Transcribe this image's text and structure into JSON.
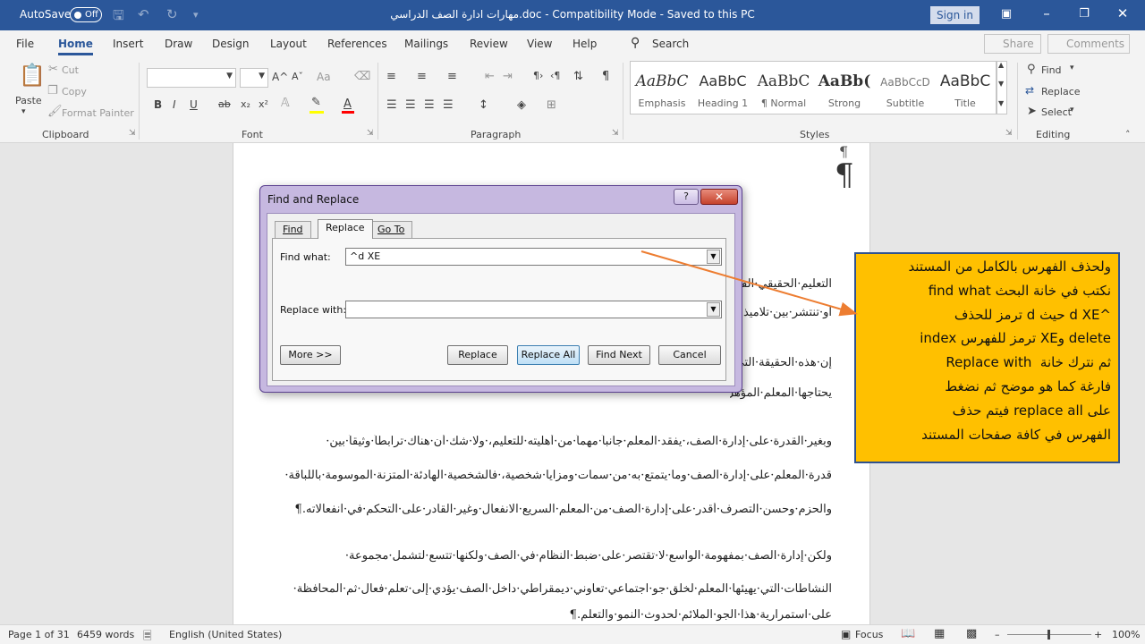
{
  "titlebar": {
    "autosave_label": "AutoSave",
    "autosave_state": "Off",
    "doc_title": "مهارات ادارة الصف الدراسي.doc  -  Compatibility Mode  -  Saved to this PC",
    "signin_label": "Sign in"
  },
  "menu": {
    "tabs": [
      "File",
      "Home",
      "Insert",
      "Draw",
      "Design",
      "Layout",
      "References",
      "Mailings",
      "Review",
      "View",
      "Help"
    ],
    "search_label": "Search",
    "share_label": "Share",
    "comments_label": "Comments"
  },
  "ribbon": {
    "clipboard": {
      "paste": "Paste",
      "cut": "Cut",
      "copy": "Copy",
      "format_painter": "Format Painter",
      "label": "Clipboard"
    },
    "font": {
      "label": "Font",
      "bold": "B",
      "italic": "I",
      "underline": "U",
      "strike": "ab",
      "subscript": "x₂",
      "superscript": "x²",
      "grow": "A^",
      "shrink": "Aˇ",
      "case": "Aa",
      "highlight_color": "#ffff00",
      "font_color": "#ff0000"
    },
    "paragraph": {
      "label": "Paragraph"
    },
    "styles": {
      "label": "Styles",
      "items": [
        {
          "sample": "AaBbC",
          "name": "Emphasis"
        },
        {
          "sample": "AaBbC",
          "name": "Heading 1"
        },
        {
          "sample": "AaBbC",
          "name": "¶ Normal"
        },
        {
          "sample": "AaBb(",
          "name": "Strong"
        },
        {
          "sample": "AaBbCcD",
          "name": "Subtitle"
        },
        {
          "sample": "AaBbC",
          "name": "Title"
        }
      ]
    },
    "editing": {
      "find": "Find",
      "replace": "Replace",
      "select": "Select",
      "label": "Editing"
    }
  },
  "document": {
    "pilcrow": "¶",
    "paragraphs": [
      "التعليم·الحقيقي·الفعال",
      "أو·تنتشر·بين·تلاميذه",
      "إن·هذه·الحقيقة·التي",
      "يحتاجها·المعلم·المؤهل.¶",
      "وبغير·القدرة·على·إدارة·الصف،·يفقد·المعلم·جانباً·مهماً·من·أهليته·للتعليم،·ولا·شك·أن·هناك·ترابطاً·وثيقاً·بين·",
      "قدرة·المعلم·على·إدارة·الصف·وما·يتمتع·به·من·سمات·ومزايا·شخصية،·فالشخصية·الهادئة·المتزنة·الموسومة·باللباقة·",
      "والحزم·وحسن·التصرف·أقدر·على·إدارة·الصف·من·المعلم·السريع·الانفعال·وغير·القادر·على·التحكم·في·انفعالاته.¶",
      "ولكن·إدارة·الصف·بمفهومة·الواسع·لا·تقتصر·على·ضبط·النظام·في·الصف·ولكنها·تتسع·لتشمل·مجموعة·",
      "النشاطات·التي·يهيئها·المعلم·لخلق·جو·اجتماعي·تعاوني·ديمقراطي·داخل·الصف·يؤدي·إلى·تعلم·فعال·ثم·المحافظة·",
      "على·استمرارية·هذا·الجو·الملائم·لحدوث·النمو·والتعلم.¶"
    ]
  },
  "dialog": {
    "title": "Find and Replace",
    "tabs": [
      "Find",
      "Replace",
      "Go To"
    ],
    "find_label": "Find what:",
    "find_value": "^d XE",
    "replace_label": "Replace with:",
    "replace_value": "",
    "buttons": {
      "more": "More >>",
      "replace": "Replace",
      "replace_all": "Replace All",
      "find_next": "Find Next",
      "cancel": "Cancel"
    }
  },
  "callout": {
    "text": "ولحذف الفهرس بالكامل من المستند\nنكتب في خانة البحث find what\n^d XE حيث d ترمز للحذف\ndelete وXE ترمز للفهرس index\nثم نترك خانة  Replace with\nفارغة كما هو موضح ثم نضغط\nعلى replace all فيتم حذف\nالفهرس في كافة صفحات المستند",
    "background": "#ffc000",
    "border": "#2f528f",
    "arrow_color": "#ed7d31"
  },
  "status": {
    "page": "Page 1 of 31",
    "words": "6459 words",
    "language": "English (United States)",
    "focus": "Focus",
    "zoom": "100%"
  }
}
